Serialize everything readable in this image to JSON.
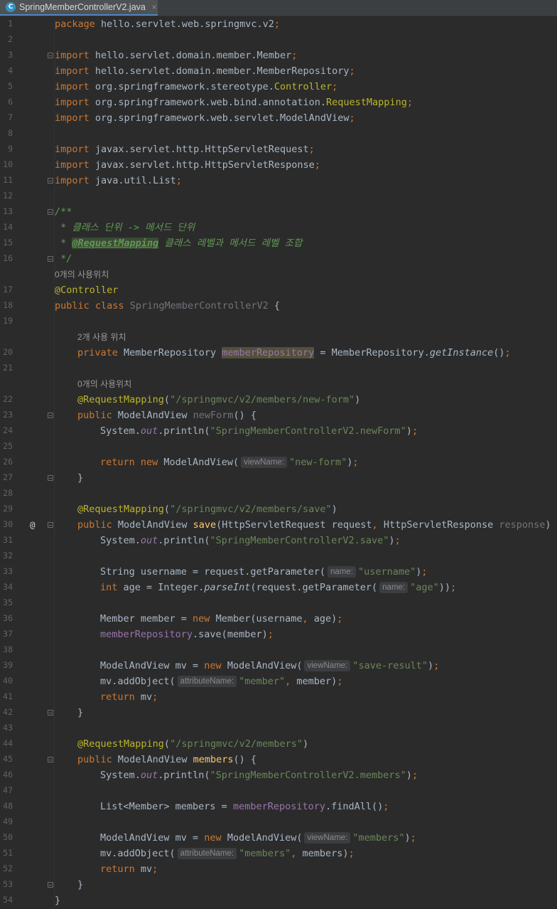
{
  "tab": {
    "title": "SpringMemberControllerV2.java",
    "icon": "C",
    "close": "×"
  },
  "lens": {
    "usage_0_a": "0개의 사용위치",
    "usage_2": "2개 사용 위치",
    "usage_0_b": "0개의 사용위치"
  },
  "hints": {
    "viewName": "viewName:",
    "name": "name:",
    "attributeName": "attributeName:"
  },
  "gutter": {
    "marker_30": "@"
  },
  "colors": {
    "background": "#2b2b2b",
    "keyword": "#cc7832",
    "string": "#6a8759",
    "annotation": "#bbb529",
    "comment": "#629755",
    "field": "#9876aa",
    "method": "#ffc66d",
    "text": "#a9b7c6"
  },
  "lines": [
    "1",
    "2",
    "3",
    "4",
    "5",
    "6",
    "7",
    "8",
    "9",
    "10",
    "11",
    "12",
    "13",
    "14",
    "15",
    "16",
    "17",
    "18",
    "19",
    "20",
    "21",
    "22",
    "23",
    "24",
    "25",
    "26",
    "27",
    "28",
    "29",
    "30",
    "31",
    "32",
    "33",
    "34",
    "35",
    "36",
    "37",
    "38",
    "39",
    "40",
    "41",
    "42",
    "43",
    "44",
    "45",
    "46",
    "47",
    "48",
    "49",
    "50",
    "51",
    "52",
    "53",
    "54"
  ],
  "code": {
    "l1_pkg": "package",
    "l1_name": " hello.servlet.web.springmvc.v2",
    "semi": ";",
    "import": "import",
    "l3": " hello.servlet.domain.member.Member",
    "l4": " hello.servlet.domain.member.MemberRepository",
    "l5_a": " org.springframework.stereotype.",
    "l5_b": "Controller",
    "l6_a": " org.springframework.web.bind.annotation.",
    "l6_b": "RequestMapping",
    "l7": " org.springframework.web.servlet.ModelAndView",
    "l9": " javax.servlet.http.HttpServletRequest",
    "l10": " javax.servlet.http.HttpServletResponse",
    "l11": " java.util.List",
    "l13": "/**",
    "l14": " * 클래스 단위 -> 메서드 단위",
    "l15_a": " * ",
    "l15_tag": "@RequestMapping",
    "l15_b": " 클래스 레벨과 메서드 레벨 조합",
    "l16": " */",
    "l17": "@Controller",
    "public": "public",
    "class": " class ",
    "l18_name": "SpringMemberControllerV2",
    "l18_brace": " {",
    "private": "private",
    "l20_type": " MemberRepository ",
    "l20_field": "memberRepository",
    "l20_eq": " = MemberRepository.",
    "l20_m": "getInstance",
    "l20_end": "()",
    "reqmap": "@RequestMapping",
    "l22_s": "\"/springmvc/v2/members/new-form\"",
    "mav": " ModelAndView ",
    "l23_m": "newForm",
    "l23_end": "() {",
    "sysout_a": "System.",
    "out": "out",
    "println": ".println(",
    "l24_s": "\"SpringMemberControllerV2.newForm\"",
    "close_paren": ")",
    "return": "return",
    "new": " new ",
    "mav_ctor": "ModelAndView(",
    "l26_s": "\"new-form\"",
    "rbrace": "}",
    "l29_s": "\"/springmvc/v2/members/save\"",
    "l30_m": "save",
    "l30_p1": "(HttpServletRequest request",
    "comma": ",",
    "l30_p2": " HttpServletResponse ",
    "l30_unused": "response",
    "l30_end": ") {",
    "l31_s": "\"SpringMemberControllerV2.save\"",
    "l33_a": "String username = request.getParameter(",
    "l33_s": "\"username\"",
    "int": "int",
    "l34_a": " age = Integer.",
    "l34_m": "parseInt",
    "l34_b": "(request.getParameter(",
    "l34_s": "\"age\"",
    "l34_end": "))",
    "l36_a": "Member member =",
    "l36_b": "Member(username",
    "l36_c": " age)",
    "l37_f": "memberRepository",
    "l37_b": ".save(member)",
    "l39_a": "ModelAndView mv =",
    "l39_s": "\"save-result\"",
    "l40_a": "mv.addObject(",
    "l40_s": "\"member\"",
    "l40_b": " member)",
    "l41_b": " mv",
    "l44_s": "\"/springmvc/v2/members\"",
    "l45_m": "members",
    "l45_end": "() {",
    "l46_s": "\"SpringMemberControllerV2.members\"",
    "l48_a": "List<Member> members = ",
    "l48_b": ".findAll()",
    "l50_s": "\"members\"",
    "l51_s": "\"members\"",
    "l51_b": " members)",
    "lparen": "("
  }
}
